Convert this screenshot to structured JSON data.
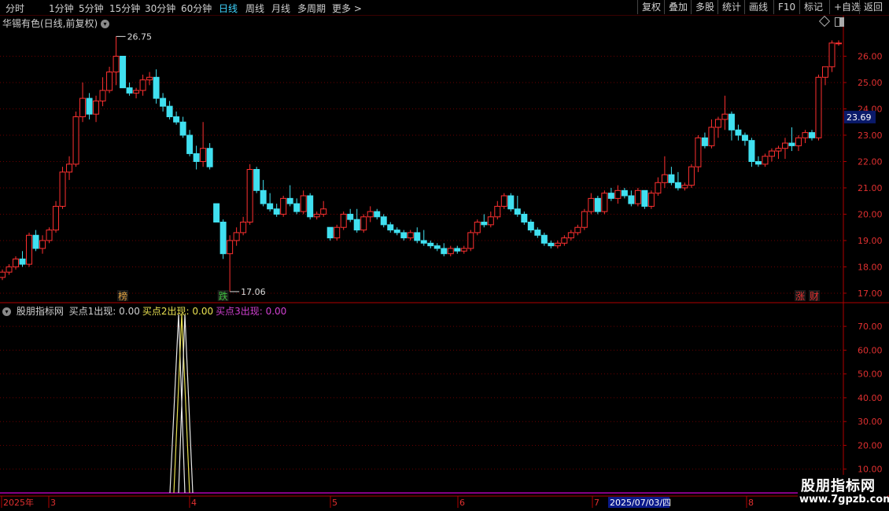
{
  "toolbar": {
    "periods": [
      "分时",
      "1分钟",
      "5分钟",
      "15分钟",
      "30分钟",
      "60分钟",
      "日线",
      "周线",
      "月线",
      "多周期",
      "更多 >"
    ],
    "active_period": "日线",
    "right_buttons": [
      "复权",
      "叠加",
      "多股",
      "统计",
      "画线",
      "F10",
      "标记",
      "+自选",
      "返回"
    ]
  },
  "stock": {
    "title": "华锡有色(日线,前复权)"
  },
  "price_axis": {
    "labels": [
      "26.00",
      "25.00",
      "24.00",
      "23.00",
      "22.00",
      "21.00",
      "20.00",
      "19.00",
      "18.00",
      "17.00"
    ],
    "current_price": "23.69"
  },
  "annotations": {
    "high_label": "26.75",
    "low_label": "17.06"
  },
  "markers": [
    {
      "text": "榜",
      "color": "#e0a040"
    },
    {
      "text": "跌",
      "color": "#40c040"
    },
    {
      "text": "涨",
      "color": "#e03030"
    },
    {
      "text": "财",
      "color": "#e03030"
    }
  ],
  "indicator": {
    "name": "股朋指标网",
    "items": [
      {
        "label": "买点1出现: 0.00",
        "color": "#d0d0d0"
      },
      {
        "label": "买点2出现: 0.00",
        "color": "#e8e050"
      },
      {
        "label": "买点3出现: 0.00",
        "color": "#d040d0"
      }
    ],
    "axis_labels": [
      "70.00",
      "60.00",
      "50.00",
      "40.00",
      "30.00",
      "20.00",
      "10.00"
    ]
  },
  "date_axis": {
    "labels": [
      {
        "text": "2025年"
      },
      {
        "text": "3"
      },
      {
        "text": "4"
      },
      {
        "text": "5"
      },
      {
        "text": "6"
      },
      {
        "text": "7"
      },
      {
        "text": "8"
      }
    ],
    "cursor_date": "2025/07/03/四"
  },
  "watermark": {
    "line1": "股朋指标网",
    "line2": "www.7gpzb.com"
  },
  "chart_data": {
    "type": "candlestick",
    "ylim": [
      16.7,
      27.0
    ],
    "up_color": "#ff3030",
    "down_color": "#40e0f0",
    "candles": [
      [
        17.6,
        17.9,
        17.5,
        17.8
      ],
      [
        17.8,
        18.1,
        17.7,
        18.0
      ],
      [
        18.0,
        18.4,
        17.9,
        18.3
      ],
      [
        18.3,
        18.6,
        18.0,
        18.1
      ],
      [
        18.1,
        19.3,
        18.0,
        19.2
      ],
      [
        19.2,
        19.4,
        18.6,
        18.7
      ],
      [
        18.7,
        19.2,
        18.5,
        19.0
      ],
      [
        19.0,
        19.5,
        18.9,
        19.4
      ],
      [
        19.4,
        20.5,
        19.3,
        20.3
      ],
      [
        20.3,
        21.8,
        20.2,
        21.6
      ],
      [
        21.6,
        22.2,
        21.3,
        21.9
      ],
      [
        21.9,
        23.9,
        21.8,
        23.7
      ],
      [
        23.7,
        25.0,
        23.5,
        24.4
      ],
      [
        24.4,
        24.6,
        23.6,
        23.8
      ],
      [
        23.8,
        24.5,
        23.5,
        24.3
      ],
      [
        24.3,
        25.2,
        24.1,
        24.7
      ],
      [
        24.7,
        25.6,
        24.6,
        25.4
      ],
      [
        25.4,
        26.75,
        24.9,
        26.0
      ],
      [
        26.0,
        25.6,
        24.8,
        24.8
      ],
      [
        24.8,
        25.0,
        24.5,
        24.6
      ],
      [
        24.6,
        24.8,
        24.4,
        24.7
      ],
      [
        24.7,
        25.3,
        24.5,
        25.1
      ],
      [
        25.1,
        25.4,
        24.9,
        25.2
      ],
      [
        25.2,
        25.5,
        24.2,
        24.4
      ],
      [
        24.4,
        24.6,
        23.9,
        24.1
      ],
      [
        24.1,
        24.3,
        23.6,
        23.7
      ],
      [
        23.7,
        23.9,
        23.4,
        23.5
      ],
      [
        23.5,
        23.7,
        22.9,
        23.0
      ],
      [
        23.0,
        23.2,
        22.2,
        22.3
      ],
      [
        22.3,
        22.6,
        21.7,
        22.0
      ],
      [
        22.0,
        23.5,
        21.8,
        22.5
      ],
      [
        22.5,
        22.7,
        21.7,
        21.8
      ],
      [
        20.4,
        20.4,
        19.7,
        19.7
      ],
      [
        19.7,
        19.8,
        18.3,
        18.5
      ],
      [
        18.5,
        19.2,
        17.06,
        19.0
      ],
      [
        19.0,
        19.5,
        18.8,
        19.3
      ],
      [
        19.3,
        19.9,
        19.2,
        19.7
      ],
      [
        19.7,
        21.9,
        19.6,
        21.7
      ],
      [
        21.7,
        21.8,
        20.8,
        20.9
      ],
      [
        20.9,
        21.3,
        20.3,
        20.4
      ],
      [
        20.4,
        20.8,
        20.1,
        20.2
      ],
      [
        20.2,
        20.4,
        19.9,
        20.0
      ],
      [
        20.0,
        20.7,
        19.9,
        20.6
      ],
      [
        20.6,
        21.1,
        20.3,
        20.4
      ],
      [
        20.4,
        20.6,
        20.0,
        20.1
      ],
      [
        20.1,
        20.9,
        20.0,
        20.7
      ],
      [
        20.7,
        20.8,
        19.8,
        19.9
      ],
      [
        19.9,
        20.1,
        19.8,
        20.0
      ],
      [
        20.0,
        20.5,
        19.9,
        20.2
      ],
      [
        19.5,
        19.5,
        19.0,
        19.1
      ],
      [
        19.1,
        19.6,
        19.0,
        19.5
      ],
      [
        19.5,
        20.1,
        19.4,
        20.0
      ],
      [
        20.0,
        20.2,
        19.7,
        19.8
      ],
      [
        19.8,
        20.2,
        19.3,
        19.4
      ],
      [
        19.4,
        20.0,
        19.3,
        19.9
      ],
      [
        19.9,
        20.3,
        19.7,
        20.1
      ],
      [
        20.1,
        20.2,
        19.8,
        19.9
      ],
      [
        19.9,
        20.0,
        19.5,
        19.6
      ],
      [
        19.6,
        19.7,
        19.3,
        19.4
      ],
      [
        19.4,
        19.5,
        19.2,
        19.3
      ],
      [
        19.3,
        19.4,
        19.0,
        19.1
      ],
      [
        19.1,
        19.4,
        19.0,
        19.3
      ],
      [
        19.3,
        19.5,
        18.9,
        19.0
      ],
      [
        19.0,
        19.4,
        18.8,
        18.9
      ],
      [
        18.9,
        19.0,
        18.7,
        18.8
      ],
      [
        18.8,
        18.9,
        18.6,
        18.7
      ],
      [
        18.7,
        18.9,
        18.4,
        18.5
      ],
      [
        18.5,
        18.8,
        18.4,
        18.7
      ],
      [
        18.7,
        18.8,
        18.5,
        18.6
      ],
      [
        18.6,
        18.8,
        18.5,
        18.7
      ],
      [
        18.7,
        19.4,
        18.6,
        19.3
      ],
      [
        19.3,
        19.8,
        19.2,
        19.7
      ],
      [
        19.7,
        20.0,
        19.5,
        19.6
      ],
      [
        19.6,
        20.1,
        19.5,
        19.9
      ],
      [
        19.9,
        20.5,
        19.8,
        20.3
      ],
      [
        20.3,
        20.8,
        20.2,
        20.7
      ],
      [
        20.7,
        20.8,
        20.1,
        20.2
      ],
      [
        20.2,
        20.7,
        19.9,
        20.0
      ],
      [
        20.0,
        20.1,
        19.6,
        19.7
      ],
      [
        19.7,
        19.8,
        19.3,
        19.4
      ],
      [
        19.4,
        19.5,
        19.1,
        19.2
      ],
      [
        19.2,
        19.3,
        18.8,
        18.9
      ],
      [
        18.9,
        19.0,
        18.7,
        18.8
      ],
      [
        18.8,
        19.0,
        18.7,
        18.9
      ],
      [
        18.9,
        19.2,
        18.8,
        19.1
      ],
      [
        19.1,
        19.4,
        19.0,
        19.3
      ],
      [
        19.3,
        19.6,
        19.2,
        19.5
      ],
      [
        19.5,
        20.2,
        19.4,
        20.1
      ],
      [
        20.1,
        20.8,
        20.0,
        20.6
      ],
      [
        20.6,
        20.7,
        20.0,
        20.1
      ],
      [
        20.1,
        20.9,
        20.0,
        20.8
      ],
      [
        20.8,
        21.0,
        20.5,
        20.6
      ],
      [
        20.6,
        21.1,
        20.4,
        20.9
      ],
      [
        20.9,
        21.0,
        20.6,
        20.7
      ],
      [
        20.7,
        20.9,
        20.3,
        20.4
      ],
      [
        20.4,
        21.0,
        20.3,
        20.9
      ],
      [
        20.9,
        20.9,
        20.2,
        20.3
      ],
      [
        20.3,
        20.9,
        20.2,
        20.8
      ],
      [
        20.8,
        21.4,
        20.7,
        21.2
      ],
      [
        21.2,
        22.2,
        21.0,
        21.5
      ],
      [
        21.5,
        21.8,
        21.1,
        21.2
      ],
      [
        21.2,
        21.6,
        20.9,
        21.0
      ],
      [
        21.0,
        21.2,
        20.9,
        21.1
      ],
      [
        21.1,
        21.9,
        21.0,
        21.8
      ],
      [
        21.8,
        23.0,
        21.6,
        22.9
      ],
      [
        22.9,
        23.1,
        22.5,
        22.6
      ],
      [
        22.6,
        23.6,
        22.5,
        23.3
      ],
      [
        23.3,
        23.7,
        22.9,
        23.6
      ],
      [
        23.6,
        24.5,
        23.2,
        23.8
      ],
      [
        23.8,
        23.9,
        22.8,
        23.2
      ],
      [
        23.2,
        23.4,
        22.8,
        23.0
      ],
      [
        23.0,
        23.1,
        22.6,
        22.8
      ],
      [
        22.8,
        22.9,
        21.8,
        22.0
      ],
      [
        22.0,
        22.2,
        21.8,
        21.9
      ],
      [
        21.9,
        22.3,
        21.8,
        22.2
      ],
      [
        22.2,
        22.5,
        22.0,
        22.4
      ],
      [
        22.4,
        22.6,
        22.1,
        22.5
      ],
      [
        22.5,
        22.9,
        22.1,
        22.7
      ],
      [
        22.7,
        23.3,
        22.4,
        22.6
      ],
      [
        22.6,
        23.0,
        22.4,
        22.9
      ],
      [
        22.9,
        23.2,
        22.7,
        23.1
      ],
      [
        23.1,
        23.2,
        22.8,
        22.9
      ],
      [
        22.9,
        25.3,
        22.8,
        25.2
      ],
      [
        25.2,
        25.6,
        24.9,
        25.6
      ],
      [
        25.6,
        26.6,
        25.4,
        26.5
      ],
      [
        26.5,
        26.6,
        26.4,
        26.5
      ]
    ]
  }
}
